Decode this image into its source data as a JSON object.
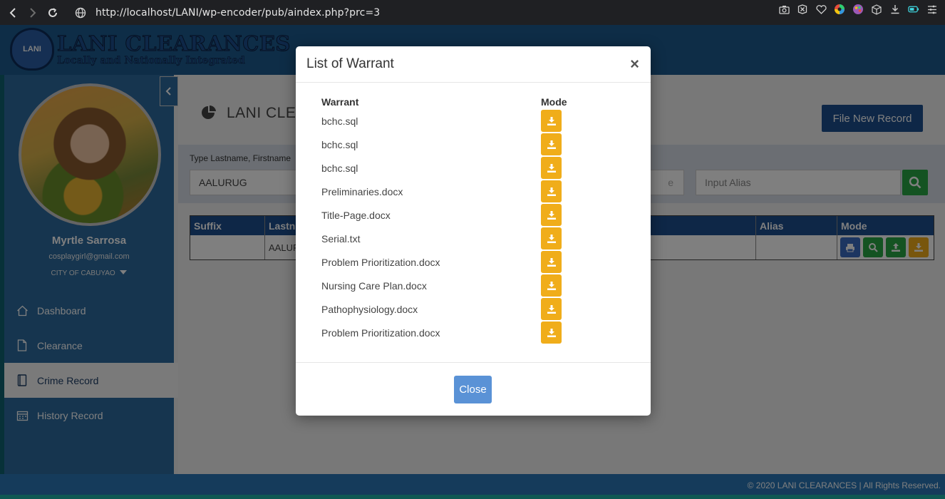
{
  "browser": {
    "url": "http://localhost/LANI/wp-encoder/pub/aindex.php?prc=3"
  },
  "header": {
    "logo_badge": "LANI",
    "logo_title": "LANI CLEARANCES",
    "logo_subtitle": "Locally and Nationally Integrated"
  },
  "sidebar": {
    "user_name": "Myrtle Sarrosa",
    "user_email": "cosplaygirl@gmail.com",
    "user_city": "CITY OF CABUYAO",
    "items": [
      {
        "label": "Dashboard",
        "icon": "home-icon"
      },
      {
        "label": "Clearance",
        "icon": "document-icon"
      },
      {
        "label": "Crime Record",
        "icon": "book-icon"
      },
      {
        "label": "History Record",
        "icon": "calendar-icon"
      }
    ]
  },
  "main": {
    "title": "LANI CLEA",
    "file_new_record": "File New Record",
    "search_label": "Type Lastname, Firstname",
    "lastname_value": "AALURUG",
    "middle_partial": "e",
    "alias_placeholder": "Input Alias",
    "table_headers": {
      "suffix": "Suffix",
      "lastname": "Lastn",
      "alias": "Alias",
      "mode": "Mode"
    },
    "table_row": {
      "suffix": "",
      "lastname": "AALUR",
      "alias": ""
    }
  },
  "modal": {
    "title": "List of Warrant",
    "close_x": "×",
    "col_warrant": "Warrant",
    "col_mode": "Mode",
    "warrants": [
      "bchc.sql",
      "bchc.sql",
      "bchc.sql",
      "Preliminaries.docx",
      "Title-Page.docx",
      "Serial.txt",
      "Problem Prioritization.docx",
      "Nursing Care Plan.docx",
      "Pathophysiology.docx",
      "Problem Prioritization.docx"
    ],
    "close_button": "Close"
  },
  "footer": {
    "text": "© 2020 LANI CLEARANCES | All Rights Reserved."
  },
  "colors": {
    "download_button": "#f0ad1a",
    "primary": "#1d4f8e",
    "close_button": "#5a92d6"
  }
}
